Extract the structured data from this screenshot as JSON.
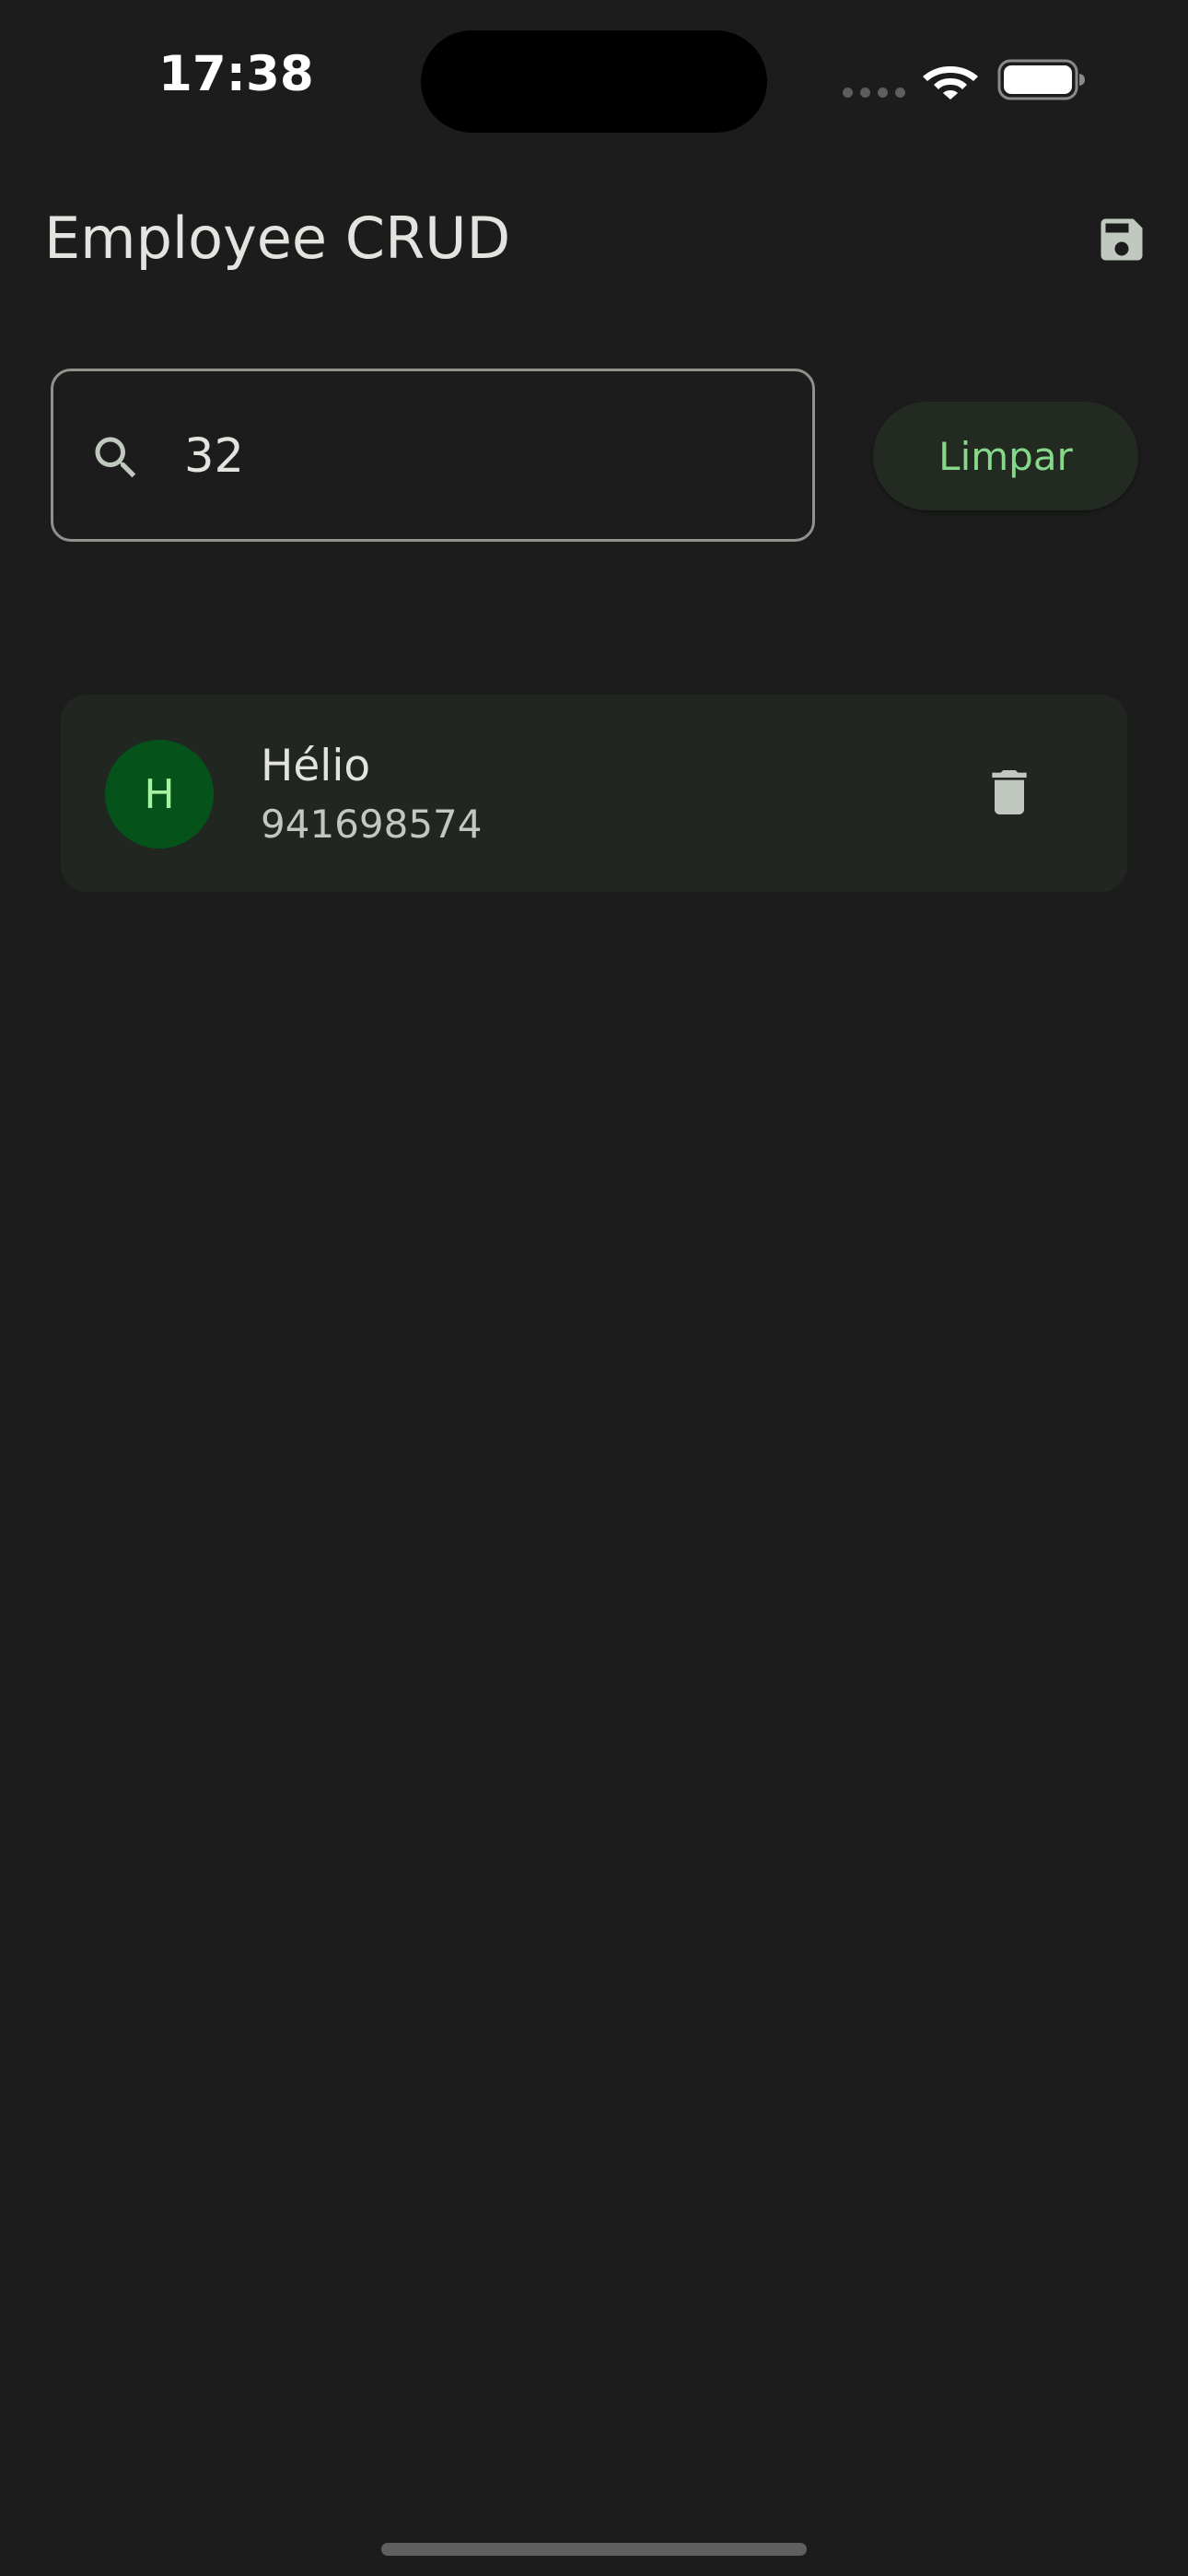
{
  "status_bar": {
    "time": "17:38",
    "icons": [
      "cellular-signal-icon",
      "wifi-icon",
      "battery-icon"
    ]
  },
  "app_bar": {
    "title": "Employee CRUD",
    "action_icon": "save-icon"
  },
  "search": {
    "icon": "search-icon",
    "value": "32",
    "clear_label": "Limpar"
  },
  "employees": [
    {
      "initial": "H",
      "name": "Hélio",
      "phone": "941698574",
      "action_icon": "delete-icon"
    }
  ],
  "colors": {
    "background": "#1b1c1b",
    "accent": "#86d98a",
    "avatar_bg": "#06521b",
    "avatar_text": "#a6f2a2",
    "card_bg": "#212621"
  }
}
